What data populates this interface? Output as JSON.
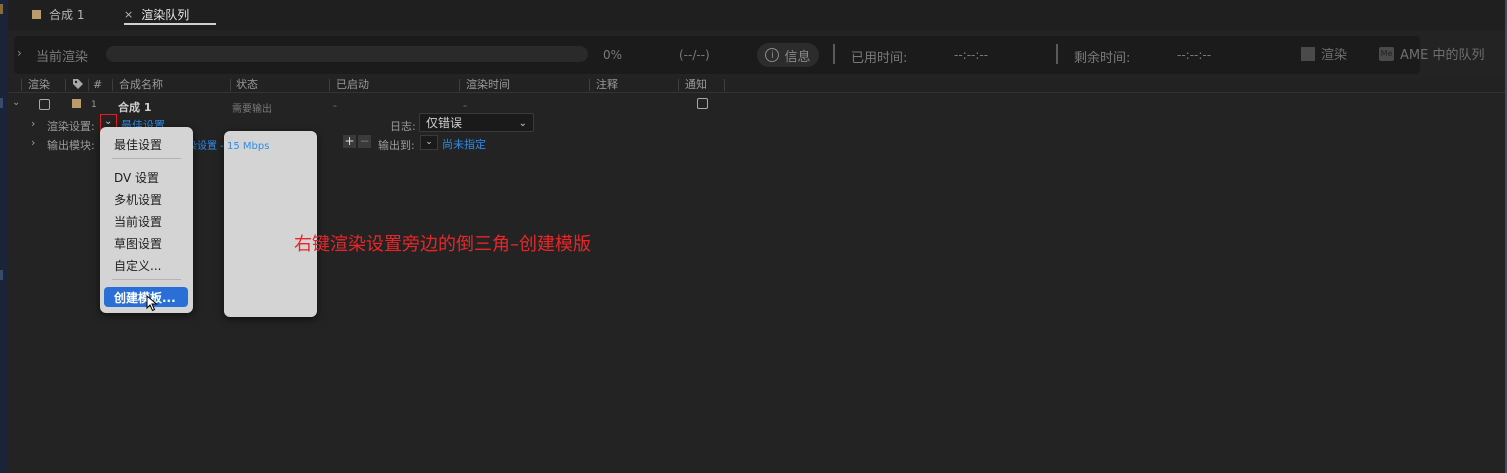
{
  "tabs": [
    {
      "label": "合成 1"
    },
    {
      "label": "渲染队列",
      "close": "×",
      "menu": "≡"
    }
  ],
  "status": {
    "title": "当前渲染",
    "progress_percent": 0,
    "percent": "0%",
    "count": "(--/--)",
    "info_label": "信息",
    "elapsed_label": "已用时间:",
    "elapsed_value": "--:--:--",
    "remaining_label": "剩余时间:",
    "remaining_value": "--:--:--"
  },
  "actions": {
    "render": "渲染",
    "ame_queue": "AME 中的队列",
    "ame_icon_text": "Me"
  },
  "columns": [
    "渲染",
    "#",
    "合成名称",
    "状态",
    "已启动",
    "渲染时间",
    "注释",
    "通知"
  ],
  "item": {
    "number": "1",
    "name": "合成 1",
    "status": "需要输出",
    "started": "-",
    "render_time": "-",
    "render_settings_label": "渲染设置:",
    "render_settings_value": "最佳设置",
    "log_label": "日志:",
    "log_value": "仅错误",
    "output_module_label": "输出模块:",
    "output_module_value": "染设置 - 15 Mbps",
    "output_to_label": "输出到:",
    "output_to_value": "尚未指定"
  },
  "dropdown_menu": {
    "items": [
      "最佳设置",
      "DV 设置",
      "多机设置",
      "当前设置",
      "草图设置",
      "自定义...",
      "创建模板..."
    ],
    "highlighted": "创建模板..."
  },
  "annotation": "右键渲染设置旁边的倒三角–创建模版",
  "colors": {
    "background": "#232323",
    "comp_label": "#b89c6c",
    "link": "#2d8ceb",
    "menu_highlight": "#2a6fd6",
    "annotation": "#e8262a"
  }
}
